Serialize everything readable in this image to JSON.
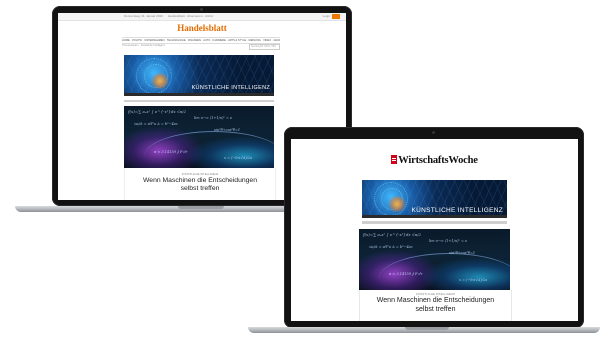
{
  "handelsblatt": {
    "topbar_left": "Donnerstag, 31. Januar 2019",
    "topbar_center": "Handelsblatt · Abonnieren · Archiv",
    "topbar_right": "Login",
    "logo": "Handelsblatt",
    "nav": "HOME · POLITIK · UNTERNEHMEN · TECHNOLOGIE · FINANZEN · AUTO · KARRIERE · ARTS & STYLE · MEINUNG · VIDEO · GRAFIKEN",
    "subnav": "Themenseiten · Künstliche Intelligenz",
    "search_placeholder": "Suchbegriff, WKN, ISIN",
    "banner_label": "KÜNSTLICHE INTELLIGENZ",
    "article_kicker": "KÜNSTLICHE INTELLIGENZ",
    "headline_line1": "Wenn Maschinen die Entscheidungen",
    "headline_line2": "selbst treffen"
  },
  "wiwo": {
    "logo": "WirtschaftsWoche",
    "banner_label": "KÜNSTLICHE INTELLIGENZ",
    "article_kicker": "KÜNSTLICHE INTELLIGENZ",
    "headline_line1": "Wenn Maschinen die Entscheidungen",
    "headline_line2": "selbst treffen"
  },
  "colors": {
    "handelsblatt_orange": "#e36b00",
    "wiwo_red": "#d0021b",
    "laptop_bezel": "#121212",
    "laptop_base": "#b0b3b7"
  }
}
